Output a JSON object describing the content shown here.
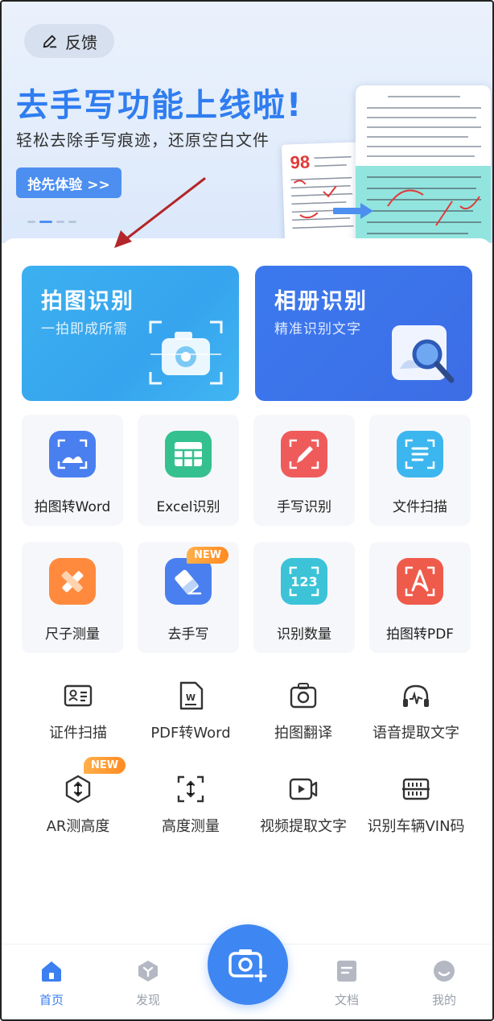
{
  "banner": {
    "feedback_label": "反馈",
    "title": "去手写功能上线啦!",
    "subtitle": "轻松去除手写痕迹，还原空白文件",
    "cta_label": "抢先体验 >>",
    "carousel_pages": 4,
    "carousel_active": 1
  },
  "cards": [
    {
      "title": "拍图识别",
      "subtitle": "一拍即成所需"
    },
    {
      "title": "相册识别",
      "subtitle": "精准识别文字"
    }
  ],
  "tiles": [
    {
      "label": "拍图转Word",
      "icon": "photo-to-word-icon",
      "color": "#4a7ff0"
    },
    {
      "label": "Excel识别",
      "icon": "excel-table-icon",
      "color": "#34c08f"
    },
    {
      "label": "手写识别",
      "icon": "handwriting-pen-icon",
      "color": "#ef5b5b"
    },
    {
      "label": "文件扫描",
      "icon": "file-scan-icon",
      "color": "#3cb6ee"
    },
    {
      "label": "尺子测量",
      "icon": "ruler-measure-icon",
      "color": "#ff8a3d"
    },
    {
      "label": "去手写",
      "icon": "eraser-icon",
      "color": "#4a7ff0",
      "badge": "NEW"
    },
    {
      "label": "识别数量",
      "icon": "count-123-icon",
      "color": "#3cc3d8"
    },
    {
      "label": "拍图转PDF",
      "icon": "photo-to-pdf-icon",
      "color": "#ef5b4b"
    }
  ],
  "tools": [
    {
      "label": "证件扫描",
      "icon": "id-card-icon"
    },
    {
      "label": "PDF转Word",
      "icon": "pdf-to-word-icon"
    },
    {
      "label": "拍图翻译",
      "icon": "photo-translate-icon"
    },
    {
      "label": "语音提取文字",
      "icon": "voice-extract-icon"
    },
    {
      "label": "AR测高度",
      "icon": "ar-height-icon",
      "badge": "NEW"
    },
    {
      "label": "高度测量",
      "icon": "height-measure-icon"
    },
    {
      "label": "视频提取文字",
      "icon": "video-extract-icon"
    },
    {
      "label": "识别车辆VIN码",
      "icon": "vin-code-icon"
    }
  ],
  "nav": [
    {
      "label": "首页",
      "icon": "home-icon",
      "active": true
    },
    {
      "label": "发现",
      "icon": "discover-icon",
      "active": false
    },
    {
      "label": "文档",
      "icon": "document-icon",
      "active": false
    },
    {
      "label": "我的",
      "icon": "profile-icon",
      "active": false
    }
  ],
  "colors": {
    "primary": "#3b7ff0",
    "banner_title": "#2f7df0",
    "card_photo": "#3cb0f0",
    "card_album": "#3d6de6",
    "badge_new": "#ff8a22",
    "annotation_arrow": "#b3262a"
  }
}
